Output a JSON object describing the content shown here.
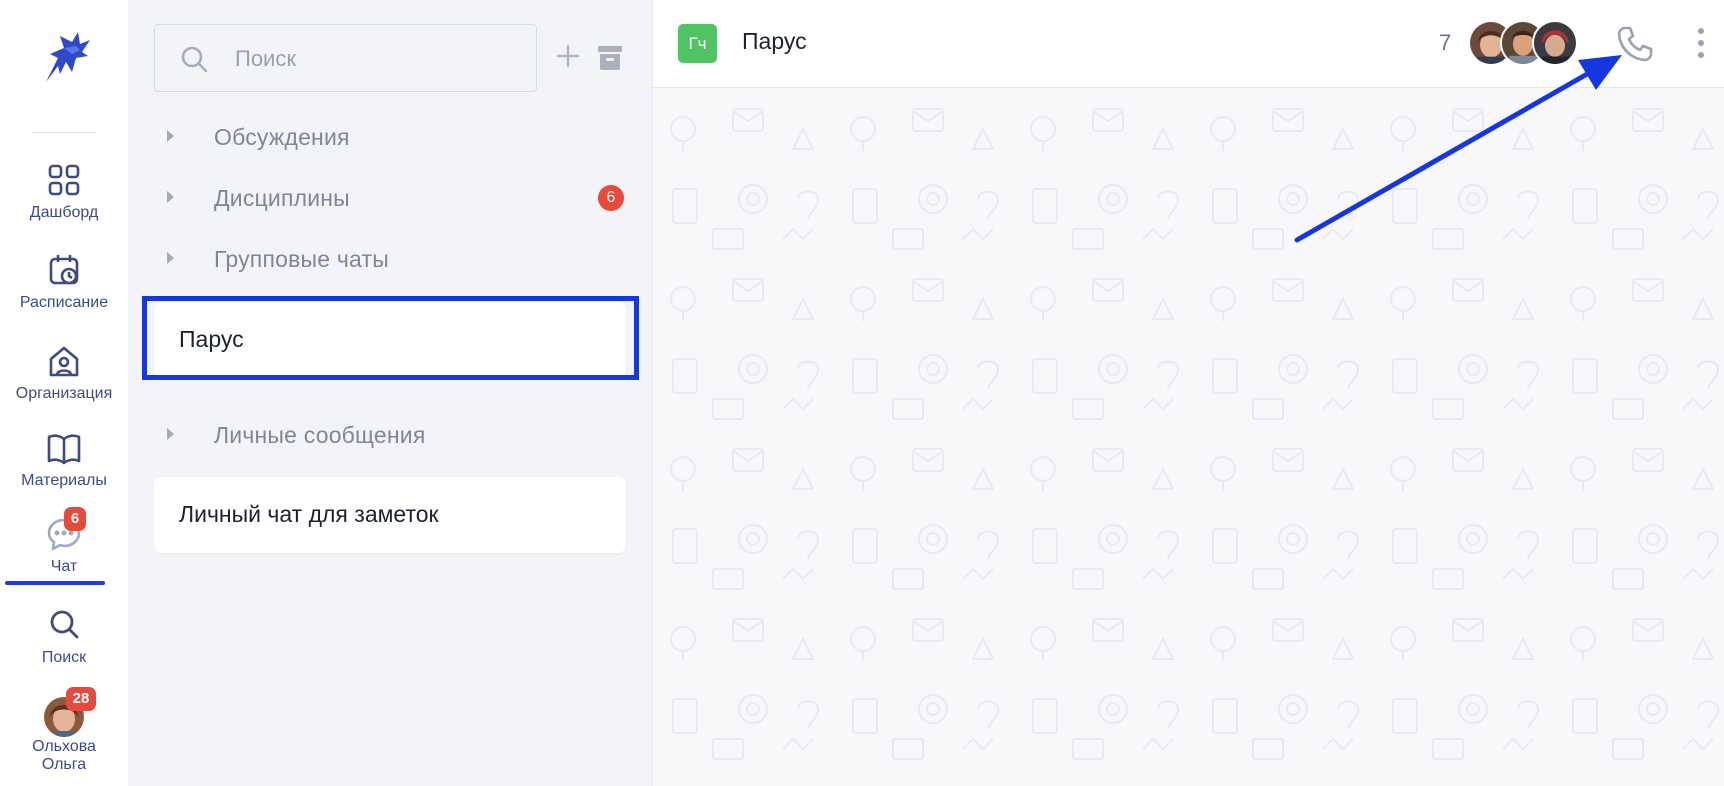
{
  "rail": {
    "items": [
      {
        "id": "dashboard",
        "label": "Дашборд",
        "icon": "grid-icon"
      },
      {
        "id": "schedule",
        "label": "Расписание",
        "icon": "calendar-clock-icon"
      },
      {
        "id": "organization",
        "label": "Организация",
        "icon": "home-user-icon"
      },
      {
        "id": "materials",
        "label": "Материалы",
        "icon": "book-icon"
      },
      {
        "id": "chat",
        "label": "Чат",
        "icon": "chat-bubble-icon",
        "badge": "6",
        "active": true
      },
      {
        "id": "search",
        "label": "Поиск",
        "icon": "search-icon"
      }
    ],
    "profile": {
      "name_line1": "Ольхова",
      "name_line2": "Ольга",
      "badge": "28"
    }
  },
  "list": {
    "search_placeholder": "Поиск",
    "groups": [
      {
        "label": "Обсуждения"
      },
      {
        "label": "Дисциплины",
        "badge": "6"
      },
      {
        "label": "Групповые чаты"
      }
    ],
    "selected_chat": "Парус",
    "personal_group": "Личные сообщения",
    "notes_chat": "Личный чат для заметок"
  },
  "conversation": {
    "avatar_initials": "Гч",
    "title": "Парус",
    "member_count": "7"
  },
  "colors": {
    "accent": "#3d4a86",
    "badge": "#e64a3c",
    "chat_avatar": "#50c364",
    "annotation": "#1537e0"
  }
}
